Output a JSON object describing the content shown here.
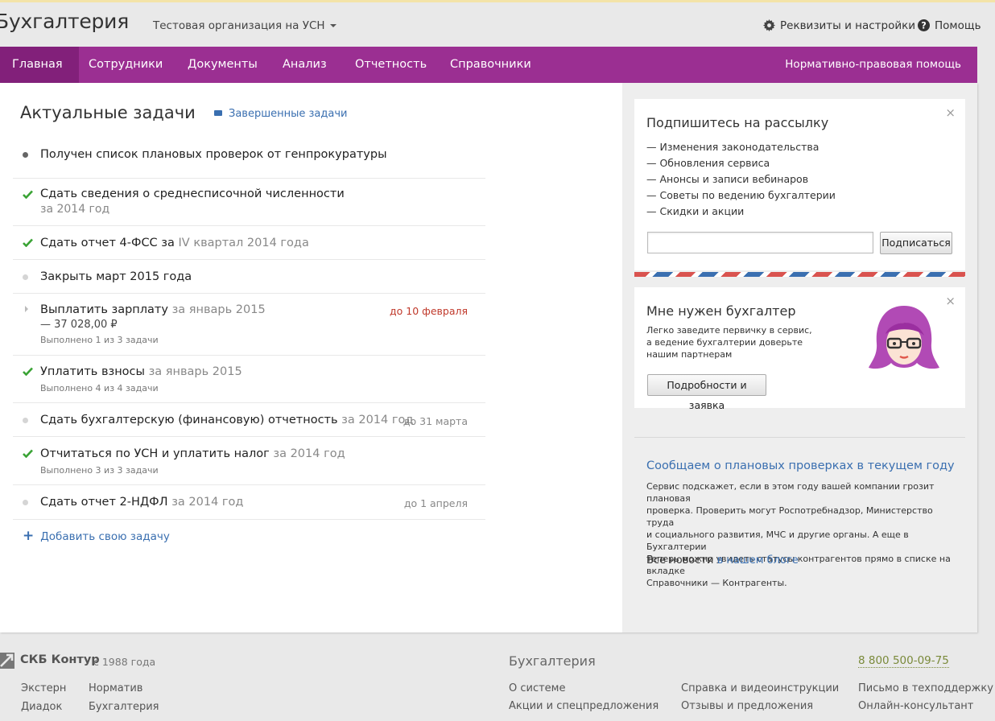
{
  "header": {
    "brand": "Бухгалтерия",
    "organization": "Тестовая организация на УСН",
    "settings_label": "Реквизиты и настройки",
    "help_label": "Помощь"
  },
  "nav": {
    "items": [
      "Главная",
      "Сотрудники",
      "Документы",
      "Анализ",
      "Отчетность",
      "Справочники"
    ],
    "active": "Главная",
    "right_label": "Нормативно-правовая помощь"
  },
  "tasks_panel": {
    "title": "Актуальные задачи",
    "completed_link": "Завершенные задачи",
    "add_task": "Добавить свою задачу",
    "tasks": [
      {
        "status": "dot-dark",
        "title": "Получен список плановых проверок от генпрокуратуры"
      },
      {
        "status": "check",
        "title": "Сдать сведения о среднесписочной численности",
        "subtitle": "за 2014 год"
      },
      {
        "status": "check",
        "title": "Сдать отчет 4-ФСС за",
        "title_gray": "IV квартал 2014 года"
      },
      {
        "status": "dot",
        "title": "Закрыть март 2015 года"
      },
      {
        "status": "arrow",
        "title": "Выплатить зарплату",
        "title_gray": "за январь 2015",
        "amount": "— 37 028,00 ₽",
        "progress": "Выполнено 1 из 3 задачи",
        "due": "до 10 февраля"
      },
      {
        "status": "check",
        "title": "Уплатить взносы",
        "title_gray": "за январь 2015",
        "progress": "Выполнено 4 из 4 задачи"
      },
      {
        "status": "dot",
        "title": "Сдать бухгалтерскую (финансовую) отчетность",
        "title_gray": "за 2014 год",
        "due": "до 31 марта"
      },
      {
        "status": "check",
        "title": "Отчитаться по УСН и уплатить налог",
        "title_gray": "за 2014 год",
        "progress": "Выполнено 3 из 3 задачи"
      },
      {
        "status": "dot",
        "title": "Сдать отчет 2-НДФЛ",
        "title_gray": "за 2014 год",
        "due": "до 1 апреля"
      }
    ]
  },
  "subscribe": {
    "title": "Подпишитесь на рассылку",
    "items": [
      "— Изменения законодательства",
      "— Обновления сервиса",
      "— Анонсы и записи вебинаров",
      "— Советы по ведению бухгалтерии",
      "— Скидки и акции"
    ],
    "input_value": "",
    "button": "Подписаться",
    "close": "×"
  },
  "accountant": {
    "title": "Мне нужен бухгалтер",
    "text_lines": [
      "Легко заведите первичку в сервис,",
      "а ведение бухгалтерии доверьте",
      "нашим партнерам"
    ],
    "button": "Подробности и заявка",
    "close": "×"
  },
  "news": {
    "title": "Сообщаем о плановых проверках в текущем году",
    "text_lines": [
      "Сервис подскажет, если в этом году вашей компании грозит плановая",
      "проверка. Проверить могут Роспотребнадзор, Министерство труда",
      "и социального развития, МЧС и другие органы. А еще в Бухгалтерии",
      "теперь можно увидеть статусы контрагентов прямо в списке на вкладке",
      "Справочники — Контрагенты."
    ],
    "blog_prefix": "Все новости",
    "blog_link": "в нашем блоге"
  },
  "footer": {
    "company": "СКБ Контур",
    "since": "с 1988 года",
    "links_col1": [
      "Экстерн",
      "Диадок"
    ],
    "links_col2": [
      "Норматив",
      "Бухгалтерия"
    ],
    "product_title": "Бухгалтерия",
    "product_links_col1": [
      "О системе",
      "Акции и спецпредложения"
    ],
    "product_links_col2": [
      "Справка и видеоинструкции",
      "Отзывы и предложения"
    ],
    "phone": "8 800 500-09-75",
    "support_links": [
      "Письмо в техподдержку",
      "Онлайн-консультант"
    ]
  },
  "colors": {
    "nav_bg": "#9b2f92",
    "nav_active": "#82207a",
    "link": "#3a6fb0",
    "check": "#3aa335",
    "due_red": "#c0392b"
  }
}
